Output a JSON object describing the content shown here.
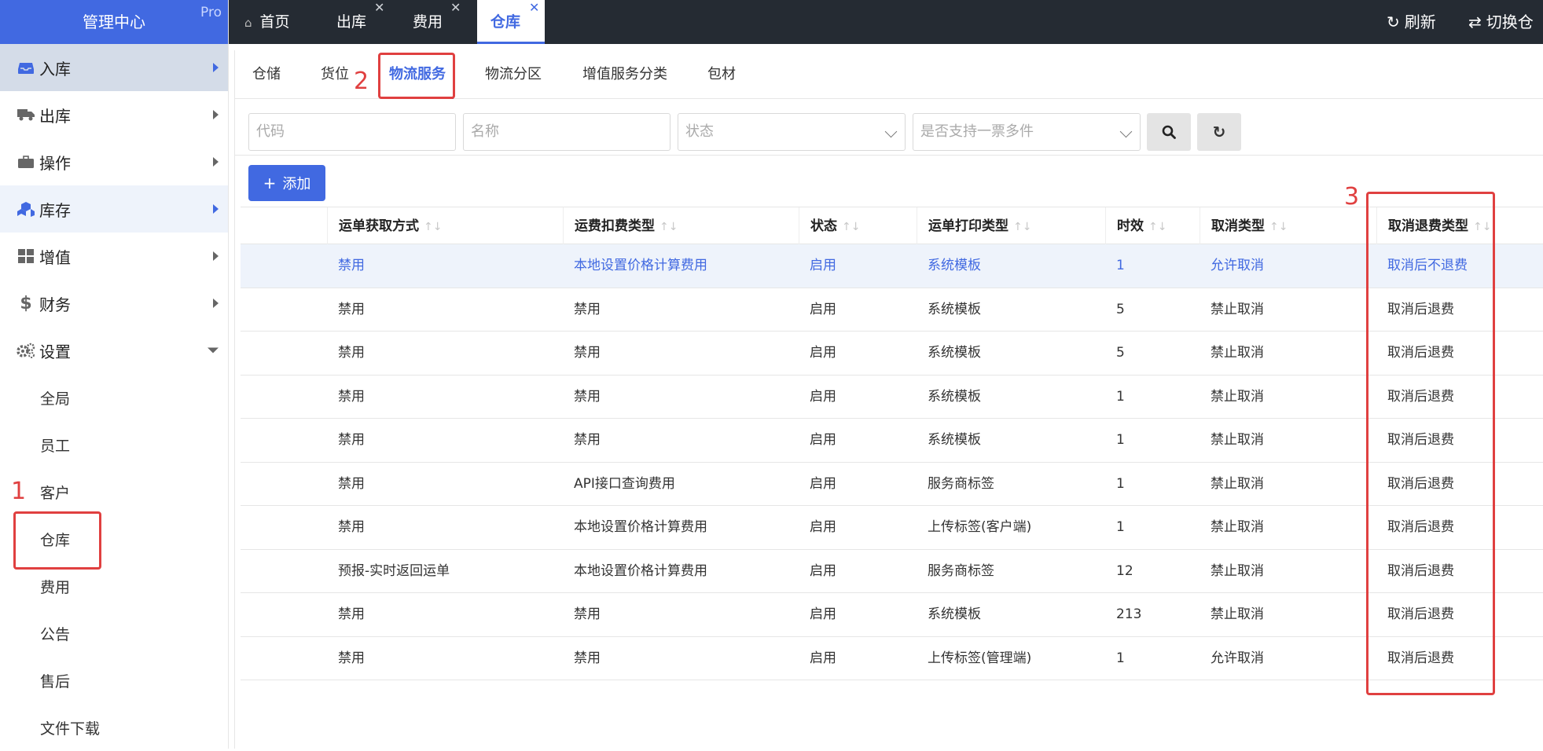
{
  "brand": {
    "title": "管理中心",
    "badge": "Pro"
  },
  "sidebar": {
    "items": [
      {
        "label": "入库",
        "icon": "inbox-icon"
      },
      {
        "label": "出库",
        "icon": "truck-icon"
      },
      {
        "label": "操作",
        "icon": "briefcase-icon"
      },
      {
        "label": "库存",
        "icon": "cubes-icon"
      },
      {
        "label": "增值",
        "icon": "grid-icon"
      },
      {
        "label": "财务",
        "icon": "dollar-icon"
      },
      {
        "label": "设置",
        "icon": "gears-icon"
      }
    ],
    "sub_items": [
      "全局",
      "员工",
      "客户",
      "仓库",
      "费用",
      "公告",
      "售后",
      "文件下载"
    ]
  },
  "topbar": {
    "tabs": [
      {
        "label": "首页",
        "icon": "home-icon"
      },
      {
        "label": "出库",
        "close": "✕"
      },
      {
        "label": "费用",
        "close": "✕"
      },
      {
        "label": "仓库",
        "close": "✕"
      }
    ],
    "refresh": "刷新",
    "switch": "切换仓"
  },
  "subtabs": [
    "仓储",
    "货位",
    "物流服务",
    "物流分区",
    "增值服务分类",
    "包材"
  ],
  "filters": {
    "code_placeholder": "代码",
    "name_placeholder": "名称",
    "status_placeholder": "状态",
    "multi_placeholder": "是否支持一票多件"
  },
  "add_button": "添加",
  "annotations": {
    "one": "1",
    "two": "2",
    "three": "3"
  },
  "table": {
    "columns": [
      "运单获取方式",
      "运费扣费类型",
      "状态",
      "运单打印类型",
      "时效",
      "取消类型",
      "取消退费类型"
    ],
    "sort_glyph": "↑↓",
    "rows": [
      [
        "禁用",
        "本地设置价格计算费用",
        "启用",
        "系统模板",
        "1",
        "允许取消",
        "取消后不退费"
      ],
      [
        "禁用",
        "禁用",
        "启用",
        "系统模板",
        "5",
        "禁止取消",
        "取消后退费"
      ],
      [
        "禁用",
        "禁用",
        "启用",
        "系统模板",
        "5",
        "禁止取消",
        "取消后退费"
      ],
      [
        "禁用",
        "禁用",
        "启用",
        "系统模板",
        "1",
        "禁止取消",
        "取消后退费"
      ],
      [
        "禁用",
        "禁用",
        "启用",
        "系统模板",
        "1",
        "禁止取消",
        "取消后退费"
      ],
      [
        "禁用",
        "API接口查询费用",
        "启用",
        "服务商标签",
        "1",
        "禁止取消",
        "取消后退费"
      ],
      [
        "禁用",
        "本地设置价格计算费用",
        "启用",
        "上传标签(客户端)",
        "1",
        "禁止取消",
        "取消后退费"
      ],
      [
        "预报-实时返回运单",
        "本地设置价格计算费用",
        "启用",
        "服务商标签",
        "12",
        "禁止取消",
        "取消后退费"
      ],
      [
        "禁用",
        "禁用",
        "启用",
        "系统模板",
        "213",
        "禁止取消",
        "取消后退费"
      ],
      [
        "禁用",
        "禁用",
        "启用",
        "上传标签(管理端)",
        "1",
        "允许取消",
        "取消后退费"
      ]
    ]
  },
  "colors": {
    "accent": "#4169e1",
    "topbar": "#252b33",
    "annotation": "#e04040"
  }
}
